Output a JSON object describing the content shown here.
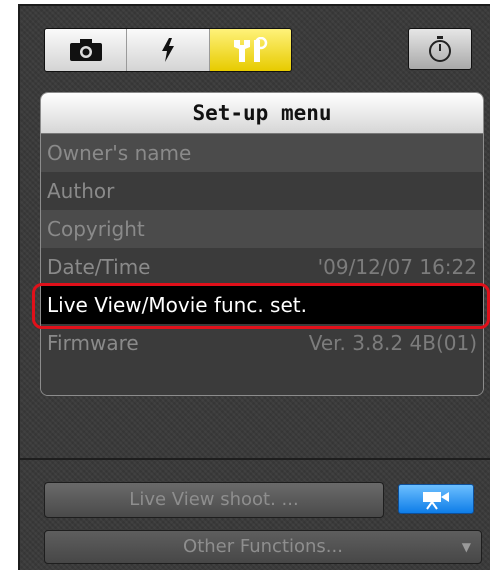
{
  "tabs": [
    {
      "icon": "camera-icon",
      "active": false
    },
    {
      "icon": "flash-icon",
      "active": false
    },
    {
      "icon": "tools-icon",
      "active": true
    }
  ],
  "timer_button": {
    "icon": "timer-icon"
  },
  "menu": {
    "title": "Set-up menu",
    "items": [
      {
        "label": "Owner's name",
        "value": ""
      },
      {
        "label": "Author",
        "value": ""
      },
      {
        "label": "Copyright",
        "value": ""
      },
      {
        "label": "Date/Time",
        "value": "'09/12/07 16:22"
      },
      {
        "label": "Live View/Movie func. set.",
        "value": "",
        "selected": true
      },
      {
        "label": "Firmware",
        "value": "Ver. 3.8.2 4B(01)"
      }
    ]
  },
  "live_view_button": {
    "label": "Live View shoot. ..."
  },
  "movie_button": {
    "icon": "movie-camera-icon"
  },
  "other_functions": {
    "label": "Other Functions...",
    "icon": "dropdown-arrow-icon"
  },
  "colors": {
    "active_tab": "#f2dc1a",
    "highlight": "#e0101a",
    "movie_button": "#1a86ee"
  }
}
